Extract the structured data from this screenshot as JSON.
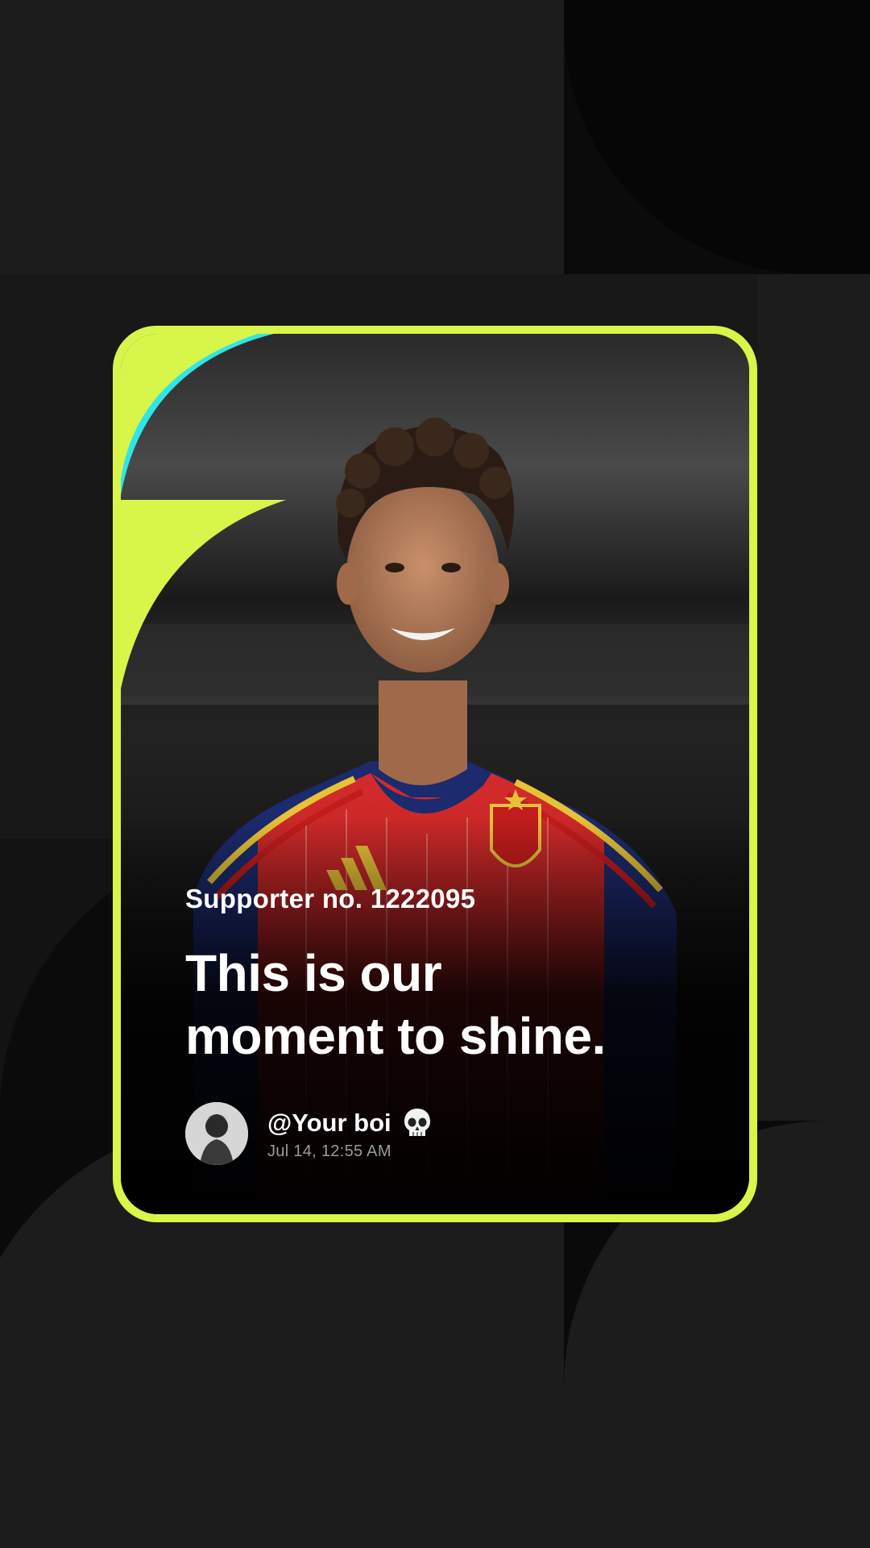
{
  "card": {
    "supporter_label": "Supporter no. 1222095",
    "headline_line1": "This is our",
    "headline_line2": "moment to shine.",
    "author": {
      "handle": "@Your boi",
      "badge_icon": "skull-icon",
      "timestamp": "Jul 14, 12:55 AM"
    }
  },
  "colors": {
    "frame": "#d8f549",
    "accent_cyan": "#2ee6e8",
    "background": "#0b0b0b",
    "shape": "#1b1b1b",
    "text": "#ffffff",
    "muted_text": "#9a9a9a"
  }
}
